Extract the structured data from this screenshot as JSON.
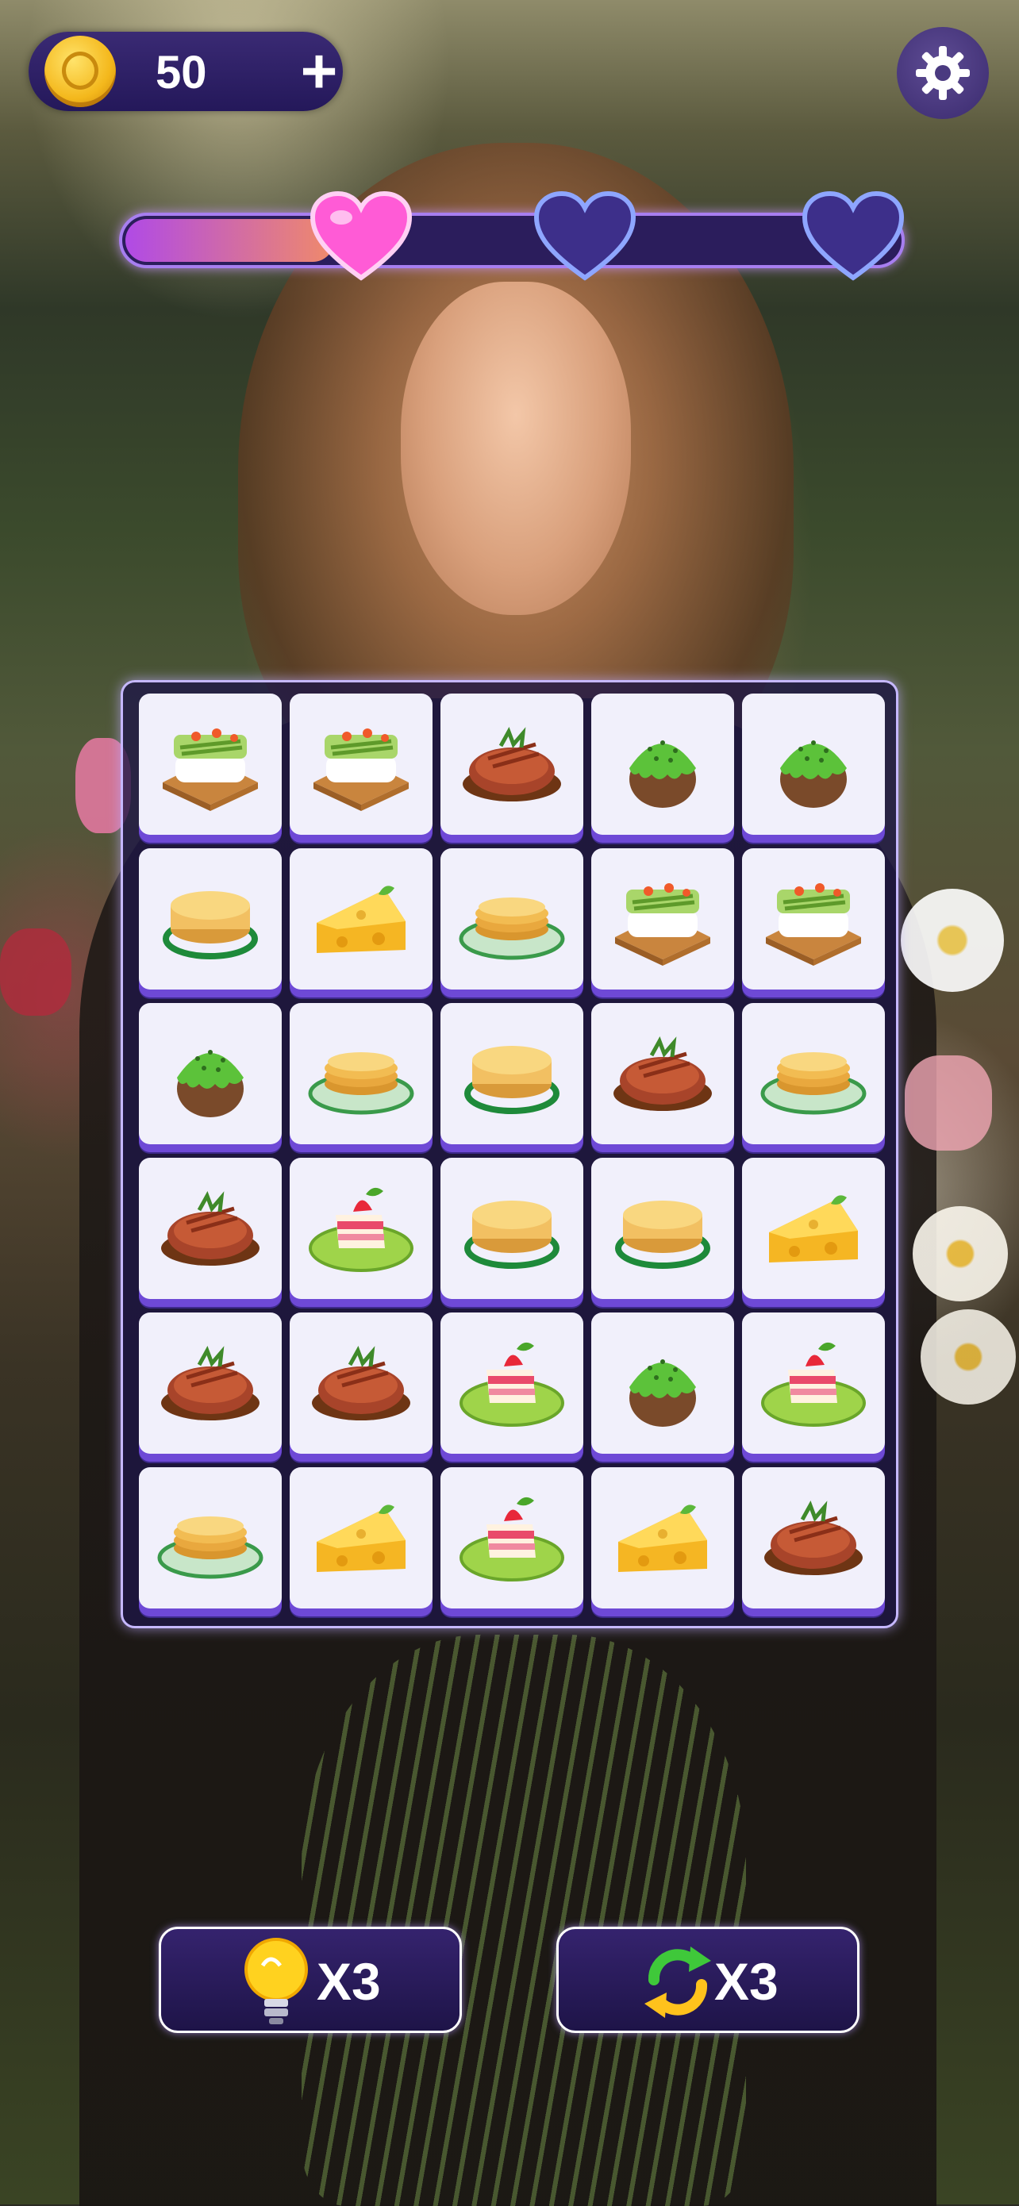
{
  "header": {
    "coins": "50",
    "add_symbol": "+",
    "coin_icon": "coin-icon",
    "settings_icon": "gear-icon"
  },
  "progress": {
    "fraction": 0.27,
    "hearts": [
      {
        "name": "heart-1",
        "state": "filled",
        "color": "#ff5bd6"
      },
      {
        "name": "heart-2",
        "state": "empty",
        "color": "#3d2f8a"
      },
      {
        "name": "heart-3",
        "state": "empty",
        "color": "#3d2f8a"
      }
    ]
  },
  "board": {
    "rows": 6,
    "cols": 5,
    "tiles": [
      [
        "sushi-icon",
        "sushi-icon",
        "steak-icon",
        "matcha-cake-icon",
        "matcha-cake-icon"
      ],
      [
        "pancake-icon",
        "cheese-icon",
        "pancake-plate-icon",
        "sushi-icon",
        "sushi-icon"
      ],
      [
        "matcha-cake-icon",
        "pancake-plate-icon",
        "pancake-icon",
        "steak-icon",
        "pancake-plate-icon"
      ],
      [
        "steak-icon",
        "strawberry-cake-icon",
        "pancake-icon",
        "pancake-icon",
        "cheese-icon"
      ],
      [
        "steak-icon",
        "steak-icon",
        "strawberry-cake-icon",
        "matcha-cake-icon",
        "strawberry-cake-icon"
      ],
      [
        "pancake-plate-icon",
        "cheese-icon",
        "strawberry-cake-icon",
        "cheese-icon",
        "steak-icon"
      ]
    ]
  },
  "powerups": {
    "hint": {
      "icon": "lightbulb-icon",
      "count": "X3"
    },
    "shuffle": {
      "icon": "shuffle-icon",
      "count": "X3"
    }
  },
  "colors": {
    "panel": "#24185a",
    "accent": "#6e49d6",
    "tile": "#f1f0fb"
  }
}
